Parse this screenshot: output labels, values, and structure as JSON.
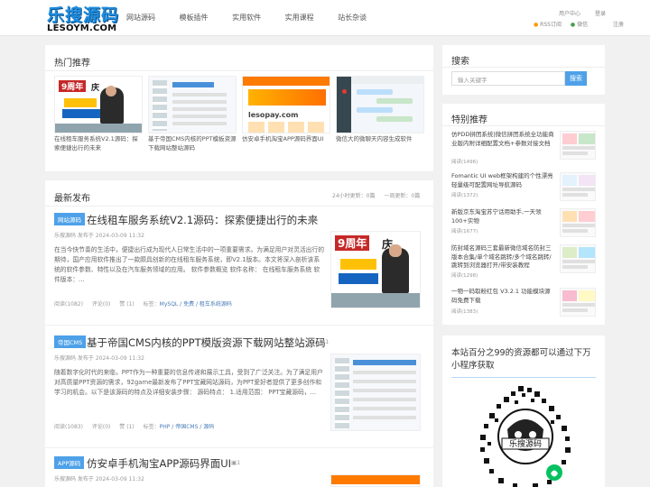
{
  "site": {
    "logo_cn": "乐搜源码",
    "logo_en": "LESOYM.COM",
    "nav": [
      "网站源码",
      "模板插件",
      "实用软件",
      "实用课程",
      "站长杂谈"
    ],
    "user_center": "用户中心",
    "login": "登录",
    "rss": "RSS订阅",
    "wechat": "微信",
    "register": "注册"
  },
  "hot": {
    "title": "热门推荐",
    "items": [
      {
        "caption": "在线租车服务系统V2.1源码：探索便捷出行的未来"
      },
      {
        "caption": "基于帝国CMS内核的PPT模板资源下载网站整站源码"
      },
      {
        "caption": "仿安卓手机淘宝APP源码界面UI"
      },
      {
        "caption": "微信大的微聊天内容生成软件"
      }
    ],
    "thumb_text": {
      "badge": "9周年",
      "year": "庆",
      "wm": "lesopay.com"
    }
  },
  "latest": {
    "title": "最新发布",
    "stats": [
      "24小时更新：0篇",
      "一周更新：0篇"
    ],
    "posts": [
      {
        "tag": "网站源码",
        "title": "在线租车服务系统V2.1源码：探索便捷出行的未来",
        "img_count": "1",
        "meta": "乐搜源码 发布于 2024-03-09 11:32",
        "excerpt": "在当今快节奏的生活中，便捷出行成为现代人日常生活中的一项重要需求。为满足用户对灵活出行的期待，国产应用软件推出了一款颇具创新的在线租车服务系统，即V2.1版本。本文将深入剖析该系统的软件参数、特性以及在汽车服务领域的应用。 软件参数概览 软件名称： 在线租车服务系统 软件版本：...",
        "reads": "阅读(1082)",
        "comments": "评论(0)",
        "likes": "赞 (1)",
        "tags_label": "标签：",
        "tags": "MySQL / 免费 / 租车系统源码"
      },
      {
        "tag": "帝国CMS",
        "title": "基于帝国CMS内核的PPT模版资源下载网站整站源码",
        "img_count": "1",
        "meta": "乐搜源码 发布于 2024-03-09 11:32",
        "excerpt": "随着数字化时代的来临，PPT作为一种重要的信息传递和展示工具，受到了广泛关注。为了满足用户对高质量PPT资源的需求，92game最新发布了PPT宝藏网站源码，为PPT爱好者提供了更多创作和学习的机会。以下是该源码的特点及详细安装步骤： 源码特点： 1.适用范围： PPT宝藏源码，...",
        "reads": "阅读(1083)",
        "comments": "评论(0)",
        "likes": "赞 (1)",
        "tags_label": "标签：",
        "tags": "PHP / 帝国CMS / 源码"
      },
      {
        "tag": "APP源码",
        "title": "仿安卓手机淘宝APP源码界面UI",
        "img_count": "1",
        "meta": "乐搜源码 发布于 2024-03-09 11:32"
      }
    ]
  },
  "search": {
    "title": "搜索",
    "placeholder": "输入关键字",
    "button": "搜索"
  },
  "special": {
    "title": "特别推荐",
    "items": [
      {
        "title": "仿PDD拼团系统|微信拼团系统全功能商业版内附详细配置文档+参数对接文档",
        "reads": "阅读(1496)"
      },
      {
        "title": "Fomantic UI web框架构建的个性漂亮轻量级可配置网址导航源码",
        "reads": "阅读(1372)"
      },
      {
        "title": "新版京东淘宝苏宁话用助手,一天领100+实物",
        "reads": "阅读(1677)"
      },
      {
        "title": "防封域名源码三套最新微信域名防封三版本合集/单个域名跳转/多个域名跳转/跳转到浏览器打开/带安装教程",
        "reads": "阅读(1298)"
      },
      {
        "title": "一物一码取粉红包 V3.2.1 功能模块源码免费下载",
        "reads": "阅读(1383)"
      }
    ]
  },
  "qr": {
    "title": "本站百分之99的资源都可以通过下万小程序获取",
    "logo_text": "乐搜源码"
  }
}
